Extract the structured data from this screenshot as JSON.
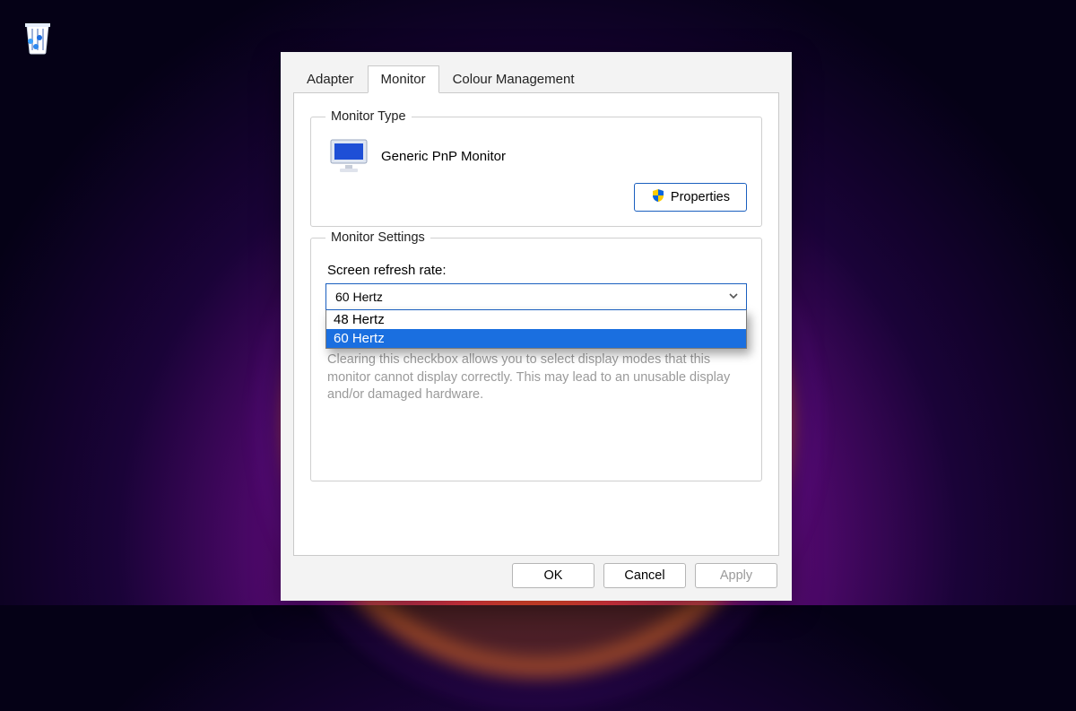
{
  "desktop": {
    "recycle_bin_name": "Recycle Bin"
  },
  "dialog": {
    "tabs": {
      "adapter": "Adapter",
      "monitor": "Monitor",
      "colour": "Colour Management",
      "active": "monitor"
    },
    "monitor_type": {
      "legend": "Monitor Type",
      "device_name": "Generic PnP Monitor",
      "properties_label": "Properties"
    },
    "monitor_settings": {
      "legend": "Monitor Settings",
      "refresh_label": "Screen refresh rate:",
      "selected_value": "60 Hertz",
      "options": [
        "48 Hertz",
        "60 Hertz"
      ],
      "hint": "Clearing this checkbox allows you to select display modes that this monitor cannot display correctly. This may lead to an unusable display and/or damaged hardware."
    },
    "buttons": {
      "ok": "OK",
      "cancel": "Cancel",
      "apply": "Apply"
    }
  }
}
